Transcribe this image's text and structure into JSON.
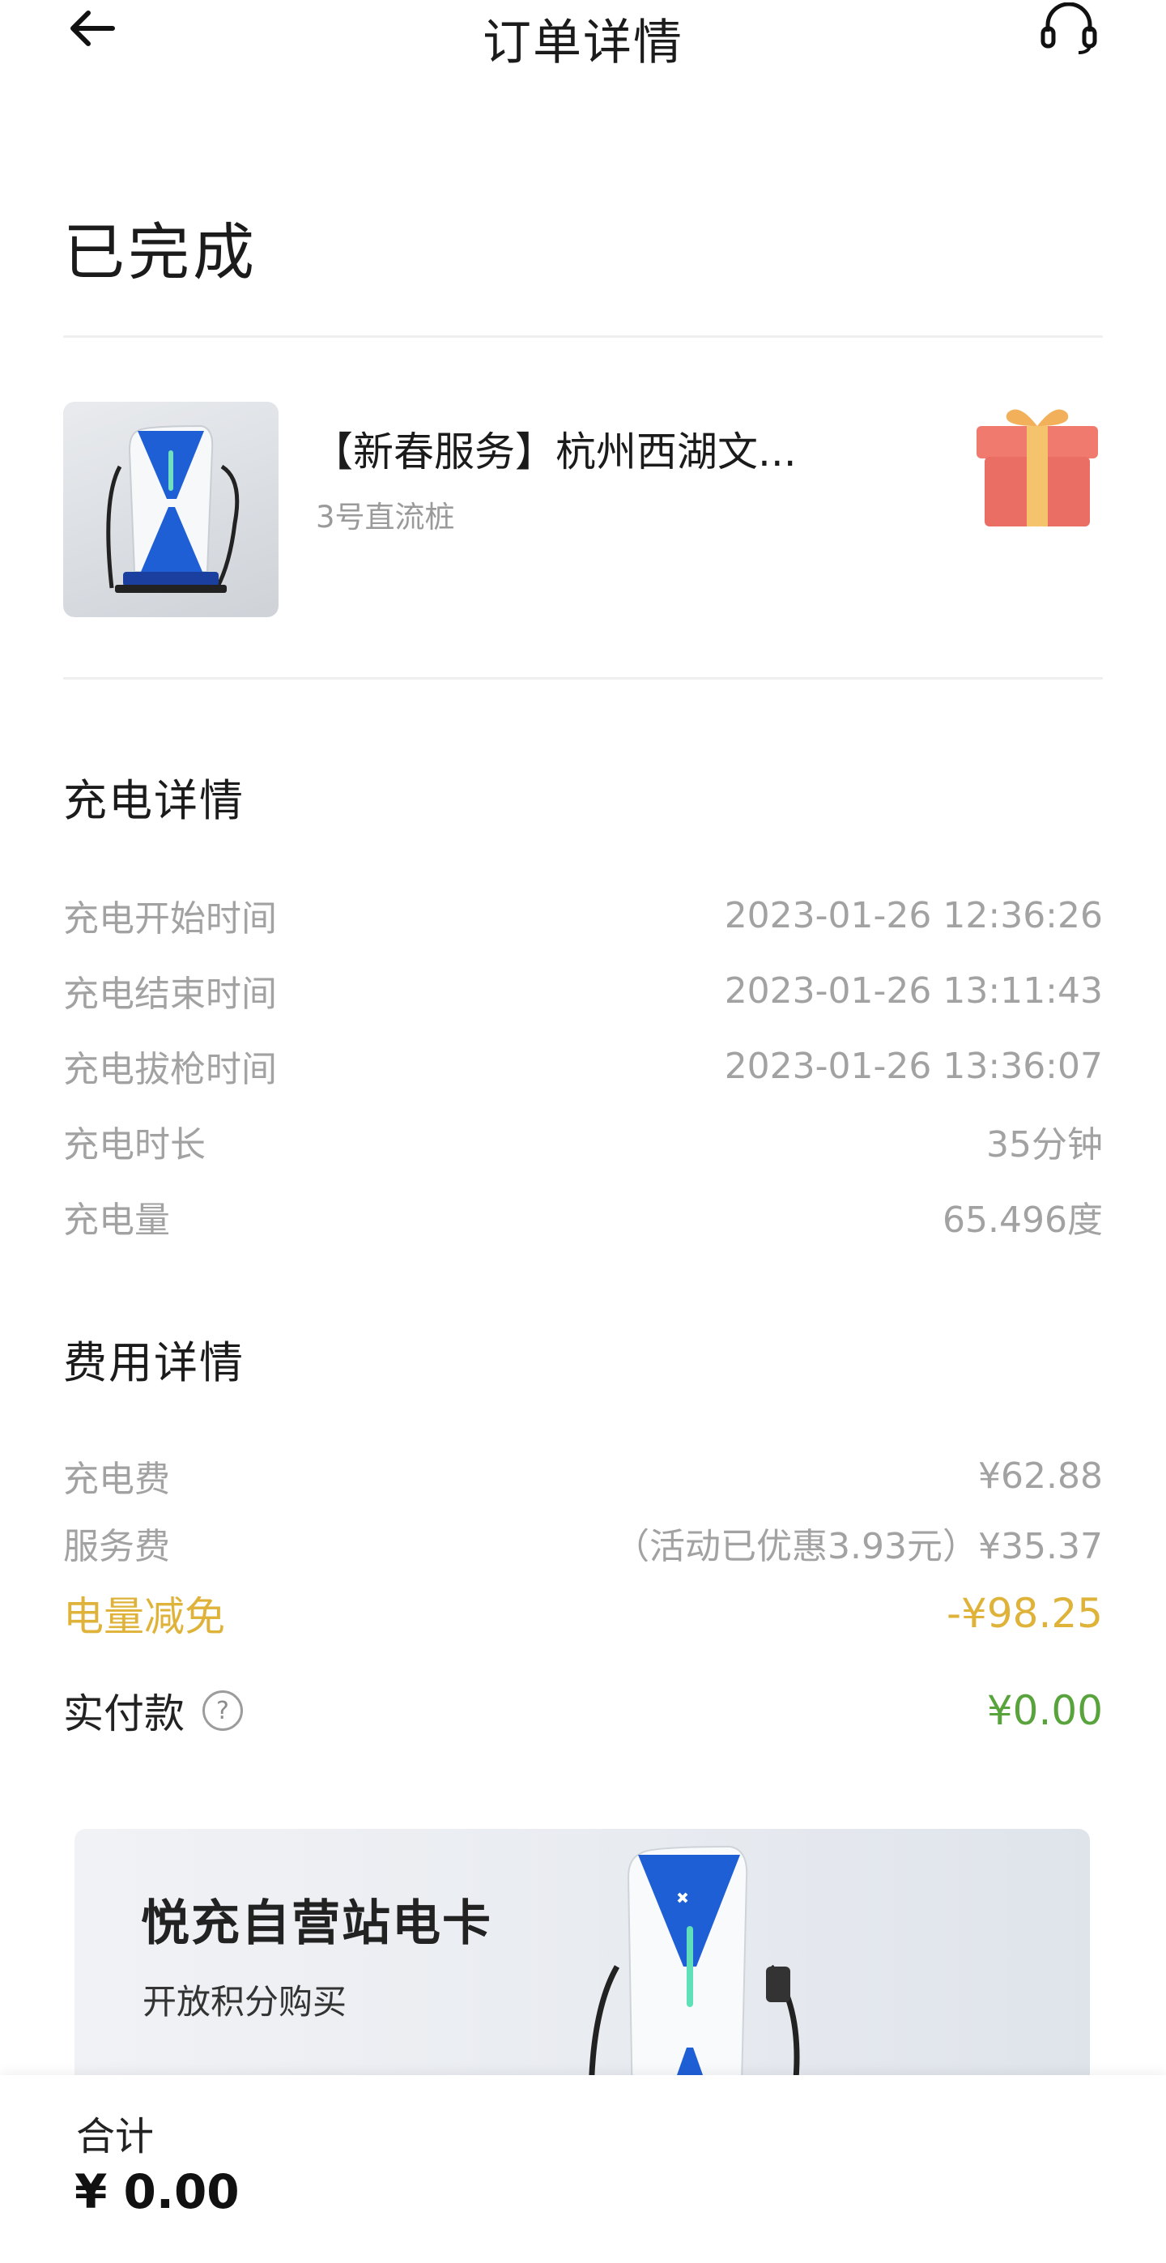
{
  "header": {
    "title": "订单详情",
    "back_icon": "arrow-left-icon",
    "service_icon": "headset-icon"
  },
  "status": "已完成",
  "station": {
    "name": "【新春服务】杭州西湖文...",
    "pile": "3号直流桩",
    "gift_icon": "gift-icon"
  },
  "charging": {
    "title": "充电详情",
    "rows": [
      {
        "label": "充电开始时间",
        "value": "2023-01-26 12:36:26"
      },
      {
        "label": "充电结束时间",
        "value": "2023-01-26 13:11:43"
      },
      {
        "label": "充电拔枪时间",
        "value": "2023-01-26 13:36:07"
      },
      {
        "label": "充电时长",
        "value": "35分钟"
      },
      {
        "label": "充电量",
        "value": "65.496度"
      }
    ]
  },
  "fees": {
    "title": "费用详情",
    "rows": [
      {
        "label": "充电费",
        "value": "¥62.88"
      },
      {
        "label": "服务费",
        "value": "（活动已优惠3.93元）¥35.37"
      },
      {
        "label": "电量减免",
        "value": "-¥98.25"
      }
    ],
    "paid": {
      "label": "实付款",
      "help": "?",
      "value": "¥0.00"
    }
  },
  "banner": {
    "title": "悦充自营站电卡",
    "subtitle": "开放积分购买"
  },
  "footer": {
    "total_label": "合计",
    "total_value": "¥ 0.00"
  },
  "colors": {
    "discount": "#dfb23a",
    "paid": "#58a33c",
    "muted": "#a2a2a2",
    "brand_blue": "#1f5fd6"
  }
}
